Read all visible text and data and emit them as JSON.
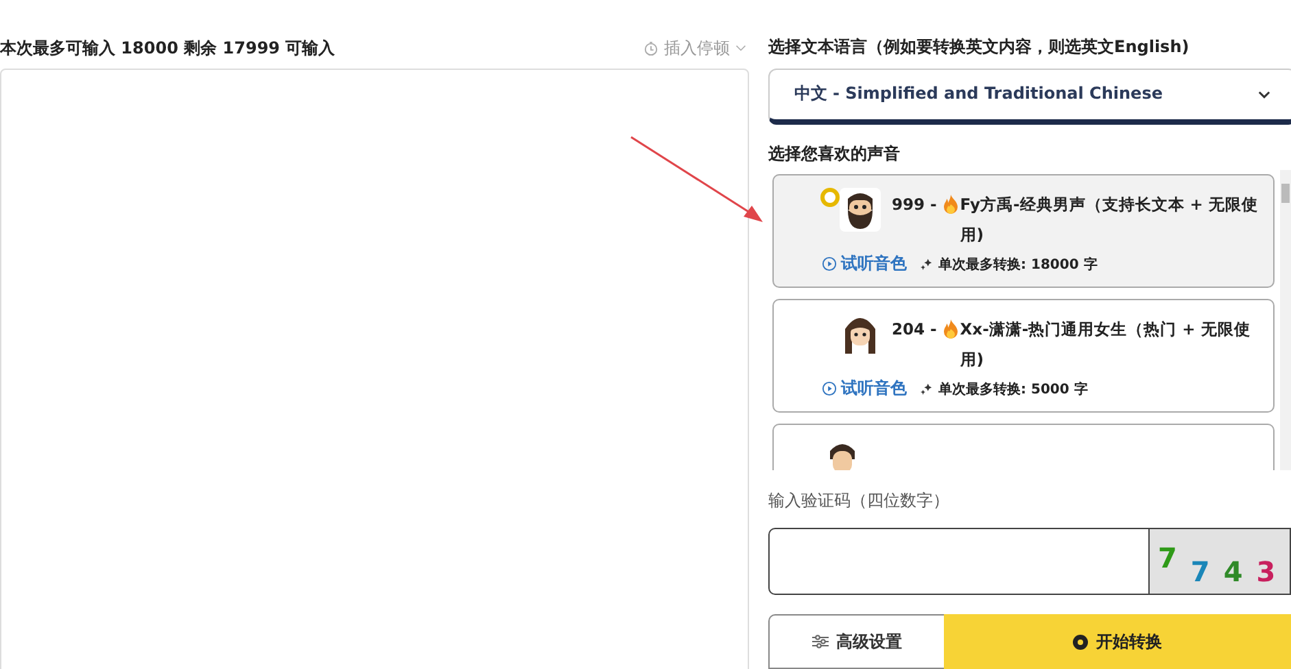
{
  "input_panel": {
    "counter": "本次最多可输入 18000 剩余 17999 可输入",
    "pause_menu": "插入停顿"
  },
  "language": {
    "label": "选择文本语言（例如要转换英文内容，则选英文English)",
    "value_main": "中文",
    "value_rest": "- Simplified and Traditional Chinese"
  },
  "voices": {
    "label": "选择您喜欢的声音",
    "items": [
      {
        "kind": "man",
        "selected": true,
        "prefix": "999 -",
        "name": "Fy方禹-经典男声（支持长文本 + 无限使用)",
        "preview": "试听音色",
        "limit": "单次最多转换: 18000 字"
      },
      {
        "kind": "woman",
        "selected": false,
        "prefix": "204 -",
        "name": "Xx-潇潇-热门通用女生（热门 + 无限使用)",
        "preview": "试听音色",
        "limit": "单次最多转换: 5000 字"
      },
      {
        "kind": "man2",
        "selected": false
      }
    ]
  },
  "captcha": {
    "label": "输入验证码（四位数字）",
    "digits": [
      {
        "text": "7",
        "color": "#2f9a18"
      },
      {
        "text": "7",
        "color": "#1a86b8"
      },
      {
        "text": "4",
        "color": "#2f8a28"
      },
      {
        "text": "3",
        "color": "#c8205e"
      }
    ]
  },
  "buttons": {
    "advanced": "高级设置",
    "start": "开始转换"
  }
}
